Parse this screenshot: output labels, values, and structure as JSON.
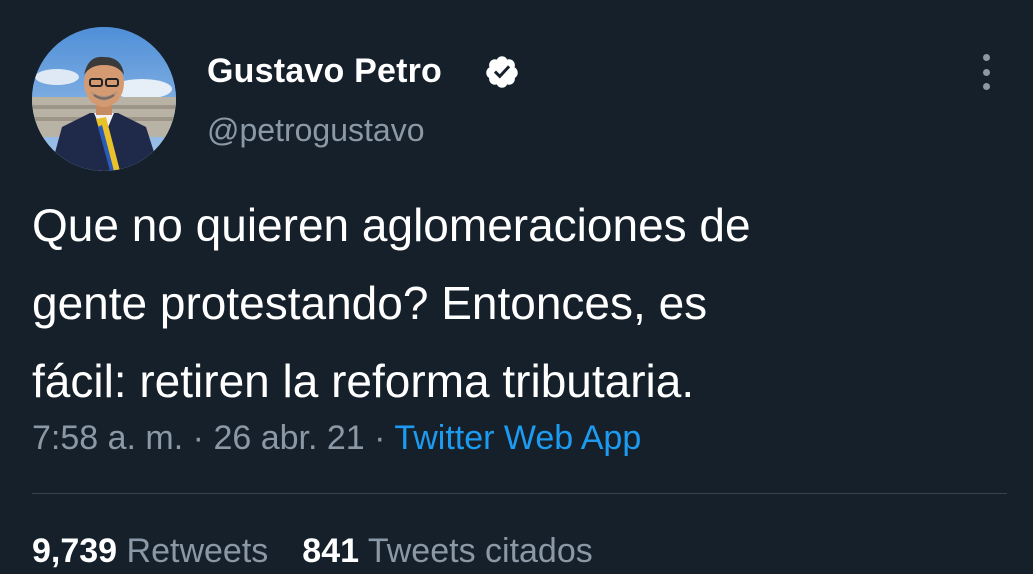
{
  "tweet": {
    "display_name": "Gustavo Petro",
    "handle": "@petrogustavo",
    "text_lines": [
      "Que no quieren aglomeraciones de",
      "gente protestando? Entonces, es",
      "fácil: retiren la reforma tributaria."
    ],
    "time": "7:58 a. m.",
    "separator": "·",
    "date": "26 abr. 21",
    "source": "Twitter Web App",
    "retweets_count": "9,739",
    "retweets_label": "Retweets",
    "quotes_count": "841",
    "quotes_label": "Tweets citados"
  },
  "icons": {
    "verified": "verified-badge-icon",
    "more": "more-vertical-icon",
    "avatar": "profile-avatar"
  },
  "colors": {
    "background": "#15202b",
    "primary_text": "#ffffff",
    "secondary_text": "#8b98a5",
    "link": "#1d9bf0",
    "divider": "#38444d"
  }
}
